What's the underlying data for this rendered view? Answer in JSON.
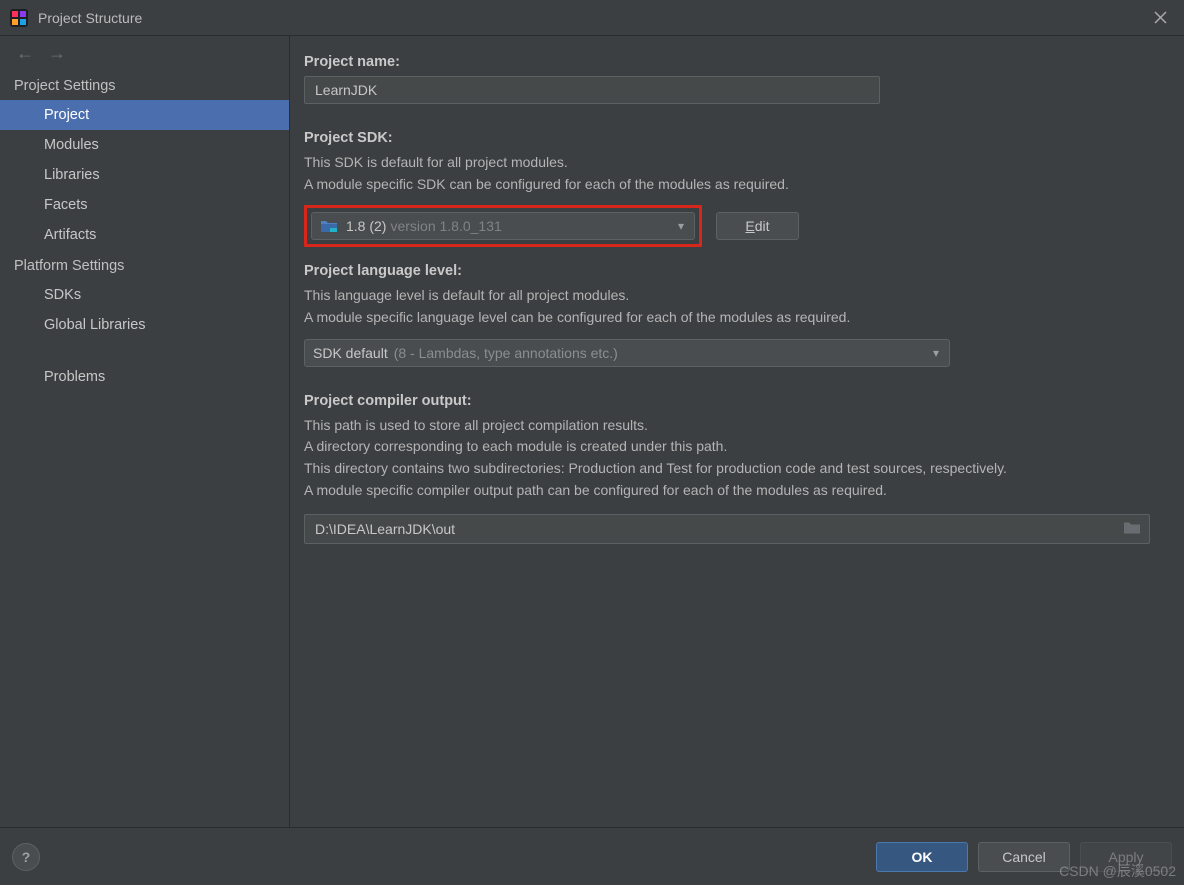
{
  "window": {
    "title": "Project Structure"
  },
  "sidebar": {
    "nav": {
      "back_enabled": false,
      "forward_enabled": false
    },
    "sections": [
      {
        "title": "Project Settings",
        "items": [
          {
            "label": "Project",
            "selected": true
          },
          {
            "label": "Modules"
          },
          {
            "label": "Libraries"
          },
          {
            "label": "Facets"
          },
          {
            "label": "Artifacts"
          }
        ]
      },
      {
        "title": "Platform Settings",
        "items": [
          {
            "label": "SDKs"
          },
          {
            "label": "Global Libraries"
          }
        ]
      },
      {
        "title": "",
        "items": [
          {
            "label": "Problems"
          }
        ]
      }
    ]
  },
  "project_name": {
    "label": "Project name:",
    "value": "LearnJDK"
  },
  "project_sdk": {
    "label": "Project SDK:",
    "desc1": "This SDK is default for all project modules.",
    "desc2": "A module specific SDK can be configured for each of the modules as required.",
    "selected": "1.8 (2)",
    "selected_detail": "version 1.8.0_131",
    "edit_label": "Edit"
  },
  "language_level": {
    "label": "Project language level:",
    "desc1": "This language level is default for all project modules.",
    "desc2": "A module specific language level can be configured for each of the modules as required.",
    "selected": "SDK default",
    "selected_detail": "(8 - Lambdas, type annotations etc.)"
  },
  "compiler_output": {
    "label": "Project compiler output:",
    "desc1": "This path is used to store all project compilation results.",
    "desc2": "A directory corresponding to each module is created under this path.",
    "desc3": "This directory contains two subdirectories: Production and Test for production code and test sources, respectively.",
    "desc4": "A module specific compiler output path can be configured for each of the modules as required.",
    "value": "D:\\IDEA\\LearnJDK\\out"
  },
  "footer": {
    "ok": "OK",
    "cancel": "Cancel",
    "apply": "Apply",
    "help": "?"
  },
  "watermark": "CSDN @辰溪0502"
}
